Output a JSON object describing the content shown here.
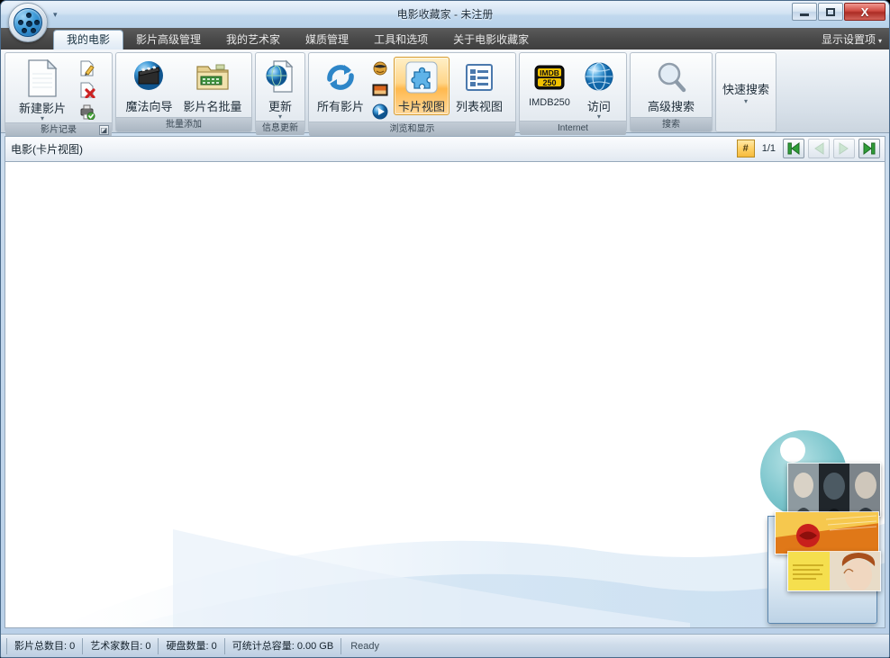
{
  "window": {
    "title": "电影收藏家 - 未注册",
    "app_icon": "film-reel-icon",
    "qat_arrow": "▾",
    "minimize": "—",
    "maximize": "❐",
    "close": "X"
  },
  "tabs": [
    {
      "label": "我的电影",
      "active": true
    },
    {
      "label": "影片高级管理",
      "active": false
    },
    {
      "label": "我的艺术家",
      "active": false
    },
    {
      "label": "媒质管理",
      "active": false
    },
    {
      "label": "工具和选项",
      "active": false
    },
    {
      "label": "关于电影收藏家",
      "active": false
    }
  ],
  "display_settings": {
    "label": "显示设置项",
    "caret": "▾"
  },
  "ribbon": {
    "groups": [
      {
        "label": "影片记录",
        "has_dialog_launcher": true,
        "dialog_launcher_glyph": "◪",
        "buttons": [
          {
            "label": "新建影片",
            "icon": "new-document-icon",
            "caret": "▾",
            "size": "large"
          }
        ],
        "small_buttons": [
          {
            "icon": "edit-document-icon"
          },
          {
            "icon": "delete-document-icon"
          },
          {
            "icon": "print-check-icon"
          }
        ]
      },
      {
        "label": "批量添加",
        "has_dialog_launcher": false,
        "buttons": [
          {
            "label": "魔法向导",
            "icon": "clapperboard-icon",
            "size": "large"
          },
          {
            "label": "影片名批量",
            "icon": "folder-film-icon",
            "size": "large"
          }
        ],
        "small_buttons": []
      },
      {
        "label": "信息更新",
        "has_dialog_launcher": false,
        "buttons": [
          {
            "label": "更新",
            "icon": "globe-document-icon",
            "caret": "▾",
            "size": "large"
          }
        ],
        "small_buttons": []
      },
      {
        "label": "浏览和显示",
        "has_dialog_launcher": false,
        "buttons": [
          {
            "label": "所有影片",
            "icon": "refresh-arrows-icon",
            "size": "large"
          },
          {
            "label": "卡片视图",
            "icon": "puzzle-piece-icon",
            "size": "large",
            "highlighted": true
          },
          {
            "label": "列表视图",
            "icon": "list-view-icon",
            "size": "large"
          }
        ],
        "small_buttons": [
          {
            "icon": "mask-icon"
          },
          {
            "icon": "picture-icon"
          },
          {
            "icon": "play-icon"
          }
        ]
      },
      {
        "label": "Internet",
        "has_dialog_launcher": false,
        "buttons": [
          {
            "label": "IMDB250",
            "icon": "imdb250-icon",
            "size": "large"
          },
          {
            "label": "访问",
            "icon": "globe-icon",
            "caret": "▾",
            "size": "large"
          }
        ],
        "small_buttons": []
      },
      {
        "label": "搜索",
        "has_dialog_launcher": false,
        "buttons": [
          {
            "label": "高级搜索",
            "icon": "magnifier-icon",
            "size": "large"
          }
        ],
        "small_buttons": []
      }
    ],
    "quick_search": {
      "label": "快速搜索",
      "caret": "▾"
    }
  },
  "page_header": {
    "title": "电影(卡片视图)",
    "hash_button": "#",
    "page_count": "1/1",
    "nav": [
      {
        "name": "first",
        "glyph": "⏮",
        "disabled": false
      },
      {
        "name": "previous",
        "glyph": "◀",
        "disabled": true
      },
      {
        "name": "next",
        "glyph": "▶",
        "disabled": true
      },
      {
        "name": "last",
        "glyph": "⏭",
        "disabled": false
      }
    ]
  },
  "content": {
    "empty": true,
    "decoration": "movie-posters-watermark"
  },
  "status_bar": {
    "panels": [
      "影片总数目: 0",
      "艺术家数目: 0",
      "硬盘数量: 0",
      "可统计总容量: 0.00 GB"
    ],
    "ready": "Ready"
  },
  "colors": {
    "accent_orange": "#ffb94e",
    "accent_green": "#2f9e38",
    "title_bar": "#c1d8ee",
    "tab_strip": "#4a4a4a",
    "close_button": "#cf4b42"
  }
}
